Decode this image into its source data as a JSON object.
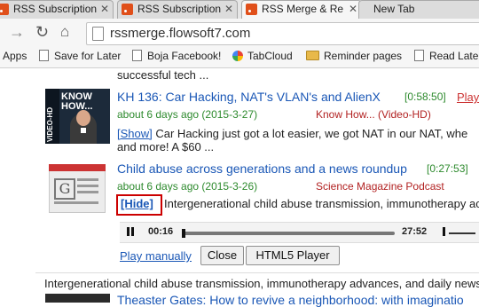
{
  "browser": {
    "tabs": [
      {
        "title": "RSS Subscription"
      },
      {
        "title": "RSS Subscription"
      },
      {
        "title": "RSS Merge & Re"
      },
      {
        "title": "New Tab"
      }
    ],
    "url": "rssmerge.flowsoft7.com"
  },
  "bookmarks": {
    "apps_label": "Apps",
    "items": [
      {
        "label": "Save for Later",
        "icon": "document-icon"
      },
      {
        "label": "Boja Facebook!",
        "icon": "document-icon"
      },
      {
        "label": "TabCloud",
        "icon": "tabcloud-icon"
      },
      {
        "label": "Reminder pages",
        "icon": "folder-icon"
      },
      {
        "label": "Read Later",
        "icon": "document-icon"
      }
    ]
  },
  "feed": {
    "prev_fragment": "successful tech ...",
    "items": [
      {
        "title": "KH 136: Car Hacking, NAT's VLAN's and AlienX",
        "duration": "[0:58:50]",
        "play_label": "Play",
        "date": "about 6 days ago (2015-3-27)",
        "channel": "Know How... (Video-HD)",
        "toggle_label": "[Show]",
        "summary_line1": "Car Hacking just got a lot easier, we got NAT in our NAT, whe",
        "summary_line2": "and more! A $60 ...",
        "thumb_text": "KNOW HOW...",
        "thumb_side": "VIDEO-HD"
      },
      {
        "title": "Child abuse across generations and a news roundup",
        "duration": "[0:27:53]",
        "date": "about 6 days ago (2015-3-26)",
        "channel": "Science Magazine Podcast",
        "toggle_label": "[Hide]",
        "summary_line1": "Intergenerational child abuse transmission, immunotherapy ac"
      }
    ],
    "player": {
      "current_time": "00:16",
      "total_time": "27:52",
      "progress": 0.01
    },
    "play_manually_label": "Play manually",
    "close_label": "Close",
    "html5_label": "HTML5 Player",
    "full_summary": "Intergenerational child abuse transmission, immunotherapy advances, and daily news",
    "next_title": "Theaster Gates: How to revive a neighborhood: with imaginatio"
  },
  "colors": {
    "highlight_box": "#cc0000",
    "link": "#1a57b6",
    "date_green": "#2d8a2d",
    "channel_red": "#b22222"
  }
}
